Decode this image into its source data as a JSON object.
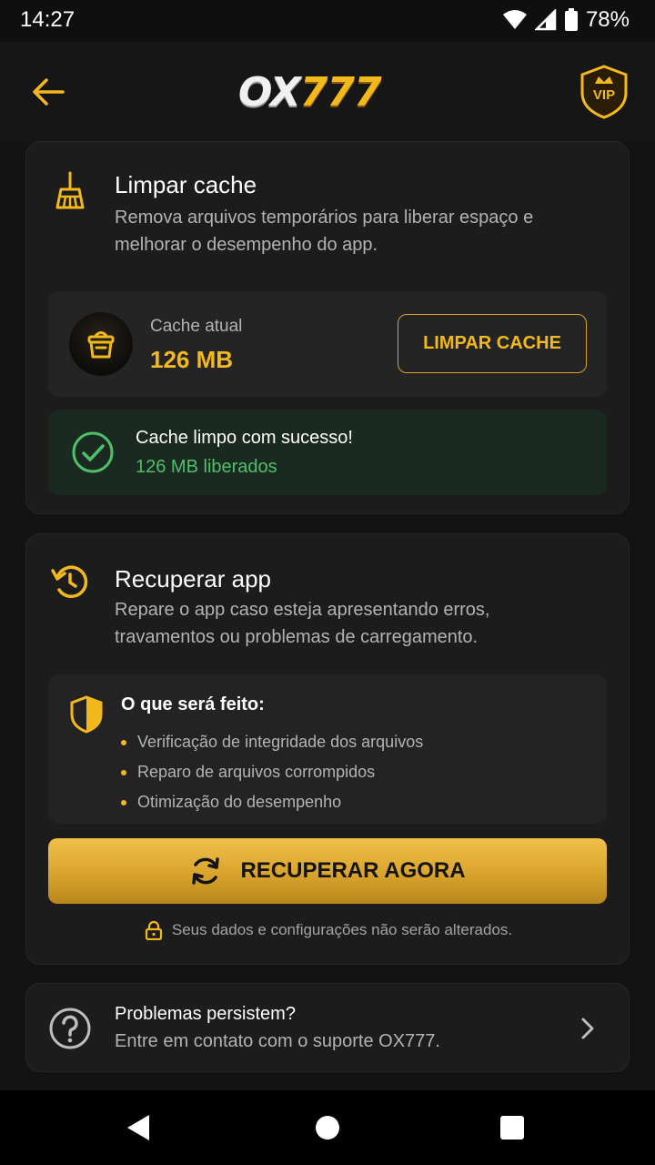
{
  "status_bar": {
    "time": "14:27",
    "battery": "78%"
  },
  "header": {
    "logo_ox": "OX",
    "logo_num": "777",
    "vip_label": "VIP",
    "icons": [
      "back-arrow-icon",
      "vip-crown-shield-icon"
    ]
  },
  "cache_section": {
    "title": "Limpar cache",
    "description": "Remova arquivos temporários para liberar espaço e melhorar o desempenho do app.",
    "current_label": "Cache atual",
    "current_value": "126 MB",
    "button_label": "LIMPAR CACHE",
    "success_title": "Cache limpo com sucesso!",
    "success_amount": "126 MB",
    "success_suffix": "liberados"
  },
  "recover_section": {
    "title": "Recuperar app",
    "description": "Repare o app caso esteja apresentando erros, travamentos ou problemas de carregamento.",
    "info_title": "O que será feito:",
    "info_items": [
      "Verificação de integridade dos arquivos",
      "Reparo de arquivos corrompidos",
      "Otimização do desempenho"
    ],
    "button_label": "RECUPERAR AGORA",
    "note": "Seus dados e configurações não serão alterados."
  },
  "support_section": {
    "title": "Problemas persistem?",
    "subtitle": "Entre em contato com o suporte OX777."
  },
  "colors": {
    "accent_gold": "#f3b91c",
    "success_green": "#4fbf6a",
    "background": "#131313",
    "card": "#1c1c1c"
  }
}
